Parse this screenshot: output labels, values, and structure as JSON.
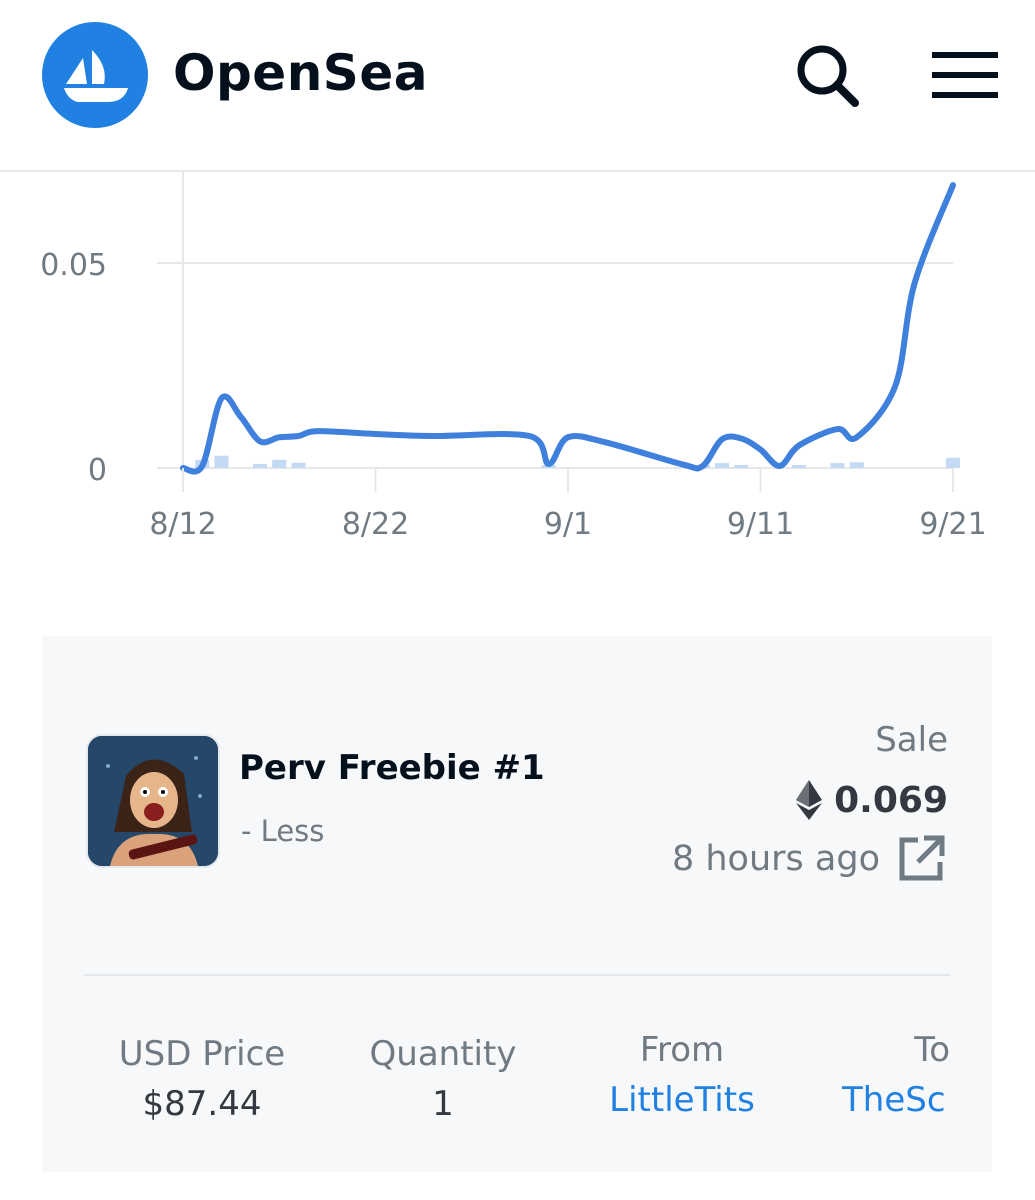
{
  "header": {
    "brand": "OpenSea",
    "colors": {
      "brand_blue": "#2081e2",
      "text_dark": "#04111d"
    },
    "icons": {
      "logo": "opensea-logo-icon",
      "search": "search-icon",
      "menu": "hamburger-menu-icon"
    }
  },
  "chart_data": {
    "type": "line",
    "title": "",
    "xlabel": "",
    "ylabel": "",
    "x_tick_labels": [
      "8/12",
      "8/22",
      "9/1",
      "9/11",
      "9/21"
    ],
    "y_tick_labels": [
      "0",
      "0.05"
    ],
    "ylim": [
      0,
      0.07
    ],
    "grid": true,
    "series": [
      {
        "color": "#3f80dd",
        "points": [
          [
            "8/12",
            0.0
          ],
          [
            "8/13",
            0.0005
          ],
          [
            "8/14",
            0.017
          ],
          [
            "8/15",
            0.0125
          ],
          [
            "8/16",
            0.0065
          ],
          [
            "8/17",
            0.0075
          ],
          [
            "8/18",
            0.0078
          ],
          [
            "8/19",
            0.009
          ],
          [
            "8/22",
            0.0083
          ],
          [
            "8/25",
            0.0078
          ],
          [
            "8/30",
            0.0078
          ],
          [
            "8/31",
            0.001
          ],
          [
            "9/1",
            0.0075
          ],
          [
            "9/3",
            0.0062
          ],
          [
            "9/7",
            0.0008
          ],
          [
            "9/8",
            0.0005
          ],
          [
            "9/9",
            0.007
          ],
          [
            "9/10",
            0.0072
          ],
          [
            "9/11",
            0.0045
          ],
          [
            "9/12",
            0.0005
          ],
          [
            "9/13",
            0.0055
          ],
          [
            "9/15",
            0.0095
          ],
          [
            "9/16",
            0.0075
          ],
          [
            "9/18",
            0.02
          ],
          [
            "9/19",
            0.045
          ],
          [
            "9/21",
            0.069
          ]
        ]
      }
    ],
    "volume_bars": [
      [
        "8/13",
        0.002
      ],
      [
        "8/14",
        0.003
      ],
      [
        "8/16",
        0.001
      ],
      [
        "8/17",
        0.002
      ],
      [
        "8/18",
        0.0013
      ],
      [
        "8/31",
        0.0003
      ],
      [
        "9/8",
        0.0005
      ],
      [
        "9/9",
        0.0012
      ],
      [
        "9/10",
        0.0004
      ],
      [
        "9/13",
        0.0003
      ],
      [
        "9/15",
        0.0012
      ],
      [
        "9/16",
        0.0014
      ],
      [
        "9/21",
        0.0025
      ]
    ]
  },
  "sale": {
    "item_name": "Perv Freebie #1",
    "item_sub": "- Less",
    "event_type": "Sale",
    "price": "0.069",
    "currency_icon": "ethereum-icon",
    "time": "8 hours ago",
    "link_icon": "external-link-icon",
    "usd_label": "USD Price",
    "usd_value": "$87.44",
    "qty_label": "Quantity",
    "qty_value": "1",
    "from_label": "From",
    "from_value": "LittleTits",
    "to_label": "To",
    "to_value": "TheSc"
  }
}
